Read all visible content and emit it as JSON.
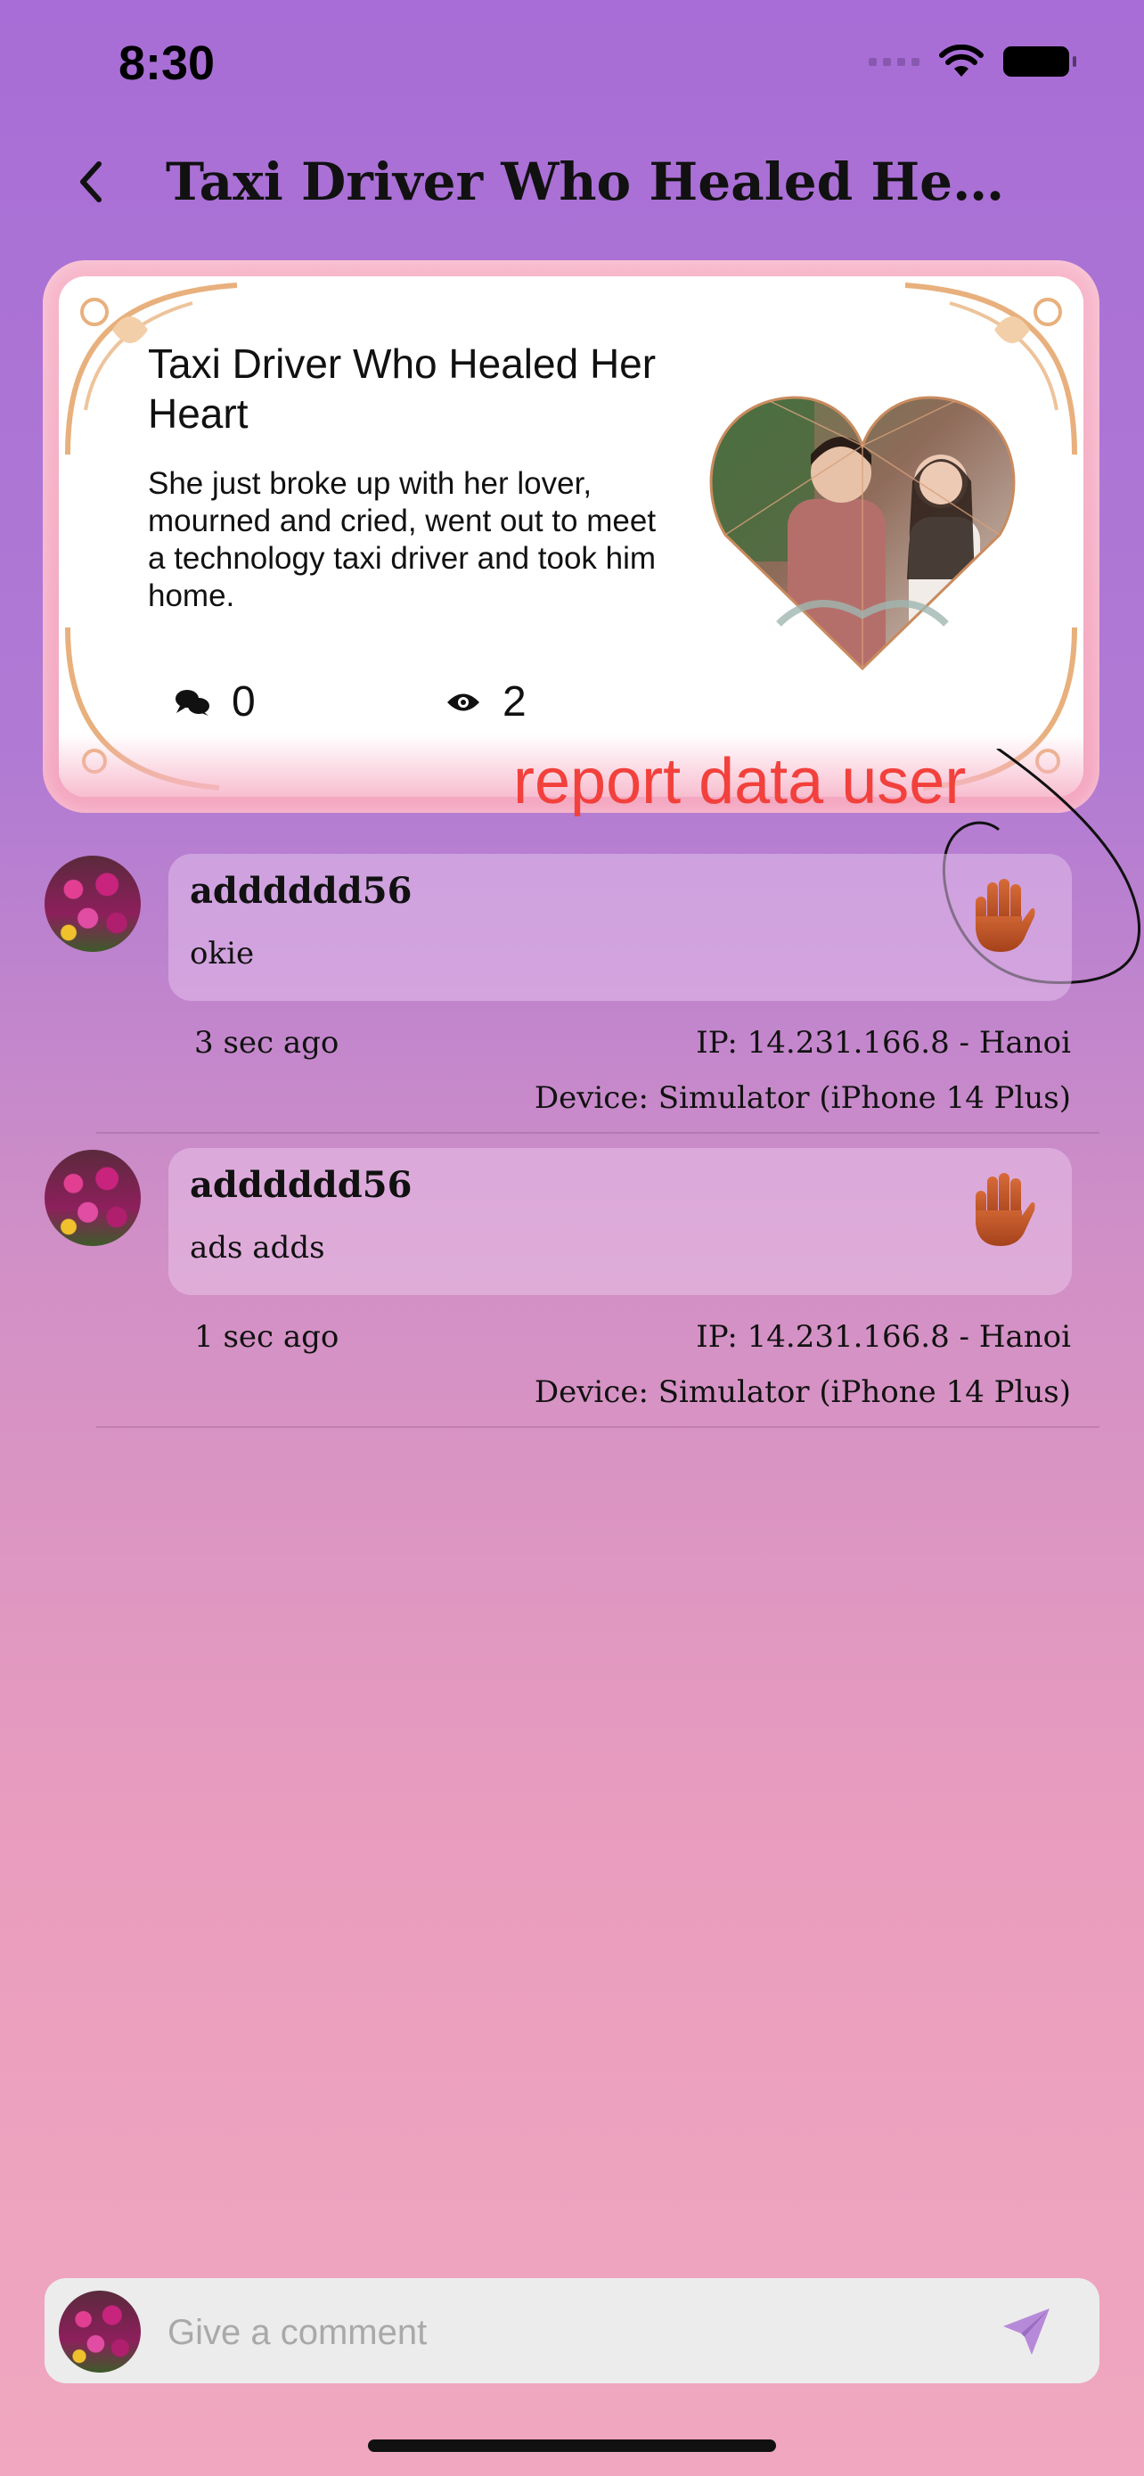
{
  "status_bar": {
    "time": "8:30"
  },
  "nav": {
    "title": "Taxi Driver Who Healed Her H..."
  },
  "story": {
    "title": "Taxi Driver Who Healed Her Heart",
    "description": "She just broke up with her lover, mourned and cried, went out to meet a technology taxi driver and took him home.",
    "comment_count": "0",
    "view_count": "2"
  },
  "annotation": {
    "text": "report data user",
    "color": "#f2413c"
  },
  "comments": [
    {
      "username": "adddddd56",
      "text": "okie",
      "time": "3 sec ago",
      "ip": "IP: 14.231.166.8 - Hanoi",
      "device": "Device: Simulator (iPhone 14 Plus)"
    },
    {
      "username": "adddddd56",
      "text": "ads adds",
      "time": "1 sec ago",
      "ip": "IP: 14.231.166.8 - Hanoi",
      "device": "Device: Simulator (iPhone 14 Plus)"
    }
  ],
  "composer": {
    "placeholder": "Give a comment"
  },
  "icons": [
    "back-chevron-icon",
    "wifi-icon",
    "battery-icon",
    "comments-icon",
    "eye-icon",
    "raised-hand-icon",
    "send-icon"
  ],
  "colors": {
    "background_top": "#a86dd6",
    "background_bottom": "#f0a7bf",
    "card_frame": "#f4a6c0",
    "send_icon": "#b78ad9"
  }
}
